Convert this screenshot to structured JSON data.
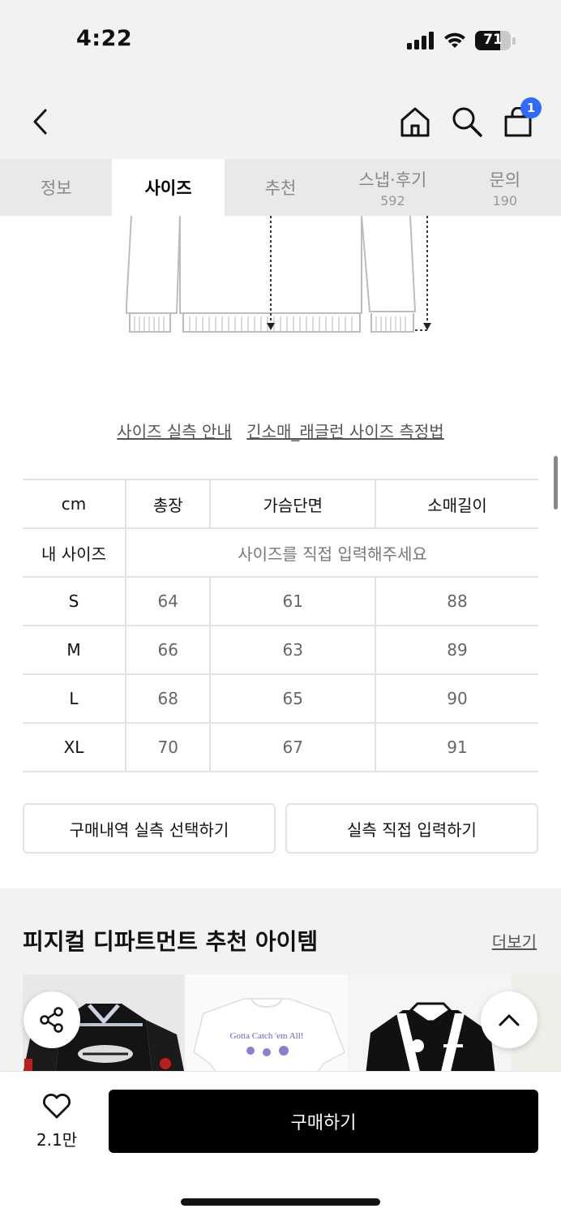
{
  "status_bar": {
    "time": "4:22",
    "battery": "71",
    "battery_level": 0.71
  },
  "nav": {
    "cart_count": "1",
    "accent_color": "#2f6bff"
  },
  "tabs": [
    {
      "label": "정보",
      "count": ""
    },
    {
      "label": "사이즈",
      "count": "",
      "active": true
    },
    {
      "label": "추천",
      "count": ""
    },
    {
      "label": "스냅·후기",
      "count": "592"
    },
    {
      "label": "문의",
      "count": "190"
    }
  ],
  "guide_links": {
    "size_guide": "사이즈 실측 안내",
    "measure_method": "긴소매_래글런 사이즈 측정법"
  },
  "size_table": {
    "unit": "cm",
    "columns": [
      "총장",
      "가슴단면",
      "소매길이"
    ],
    "my_size_label": "내 사이즈",
    "my_size_placeholder": "사이즈를 직접 입력해주세요",
    "rows": [
      {
        "size": "S",
        "values": [
          "64",
          "61",
          "88"
        ]
      },
      {
        "size": "M",
        "values": [
          "66",
          "63",
          "89"
        ]
      },
      {
        "size": "L",
        "values": [
          "68",
          "65",
          "90"
        ]
      },
      {
        "size": "XL",
        "values": [
          "70",
          "67",
          "91"
        ]
      }
    ]
  },
  "measure_buttons": {
    "purchase_history": "구매내역 실측 선택하기",
    "direct_input": "실측 직접 입력하기"
  },
  "recommendations": {
    "title": "피지컬 디파트먼트 추천 아이템",
    "more": "더보기",
    "product2_print": "Gotta Catch 'em All!"
  },
  "bottom_bar": {
    "like_count": "2.1만",
    "buy_label": "구매하기"
  }
}
